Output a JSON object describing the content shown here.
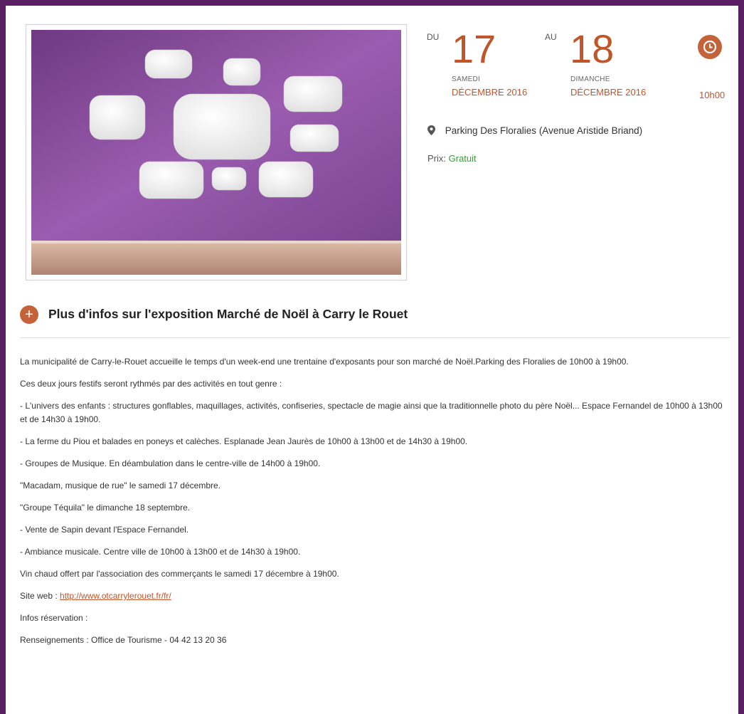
{
  "event": {
    "du_label": "DU",
    "au_label": "AU",
    "start": {
      "day": "17",
      "weekday": "SAMEDI",
      "month_year": "DÉCEMBRE 2016"
    },
    "end": {
      "day": "18",
      "weekday": "DIMANCHE",
      "month_year": "DÉCEMBRE 2016"
    },
    "time": "10h00",
    "location": "Parking Des Floralies (Avenue Aristide Briand)",
    "price_label": "Prix:",
    "price_value": "Gratuit"
  },
  "icons": {
    "clock": "clock-icon",
    "pin": "map-pin-icon",
    "plus": "plus-icon"
  },
  "colors": {
    "accent": "#c0552a",
    "frame": "#5a1f63",
    "price": "#3a9a3a"
  },
  "info": {
    "title": "Plus d'infos sur l'exposition Marché de Noël à Carry le Rouet",
    "paragraphs": [
      "La municipalité de Carry-le-Rouet accueille le temps d'un week-end une trentaine d'exposants pour son marché de Noël.Parking des Floralies de 10h00 à 19h00.",
      "Ces deux jours festifs seront rythmés par des activités en tout genre :",
      "- L'univers des enfants : structures gonflables, maquillages, activités, confiseries, spectacle de magie ainsi que la traditionnelle photo du père Noël... Espace Fernandel de 10h00 à 13h00 et de 14h30 à 19h00.",
      "- La ferme du Piou et balades en poneys et calèches. Esplanade Jean Jaurès de 10h00 à 13h00 et de 14h30 à 19h00.",
      "- Groupes de Musique. En déambulation dans le centre-ville de 14h00 à 19h00.",
      "\"Macadam, musique de rue\" le samedi 17 décembre.",
      "\"Groupe Téquila\" le dimanche 18 septembre.",
      "- Vente de Sapin devant l'Espace Fernandel.",
      "- Ambiance musicale. Centre ville de 10h00 à 13h00 et de 14h30 à 19h00.",
      "Vin chaud offert par l'association des commerçants le samedi 17 décembre à 19h00."
    ],
    "website_label": "Site web : ",
    "website_url": "http://www.otcarrylerouet.fr/fr/",
    "reservation_label": "Infos réservation :",
    "contact": "Renseignements : Office de Tourisme - 04 42 13 20 36"
  }
}
